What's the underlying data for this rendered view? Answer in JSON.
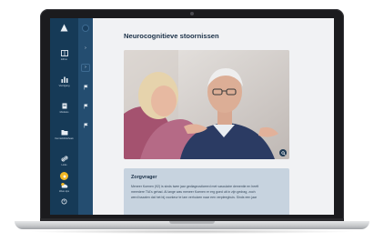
{
  "sidebar": {
    "items": [
      {
        "label": "Ethos",
        "icon": "book-icon"
      },
      {
        "label": "Voortgang",
        "icon": "bar-chart-icon"
      },
      {
        "label": "Modules",
        "icon": "document-stack-icon"
      },
      {
        "label": "Kennisbibliotheek",
        "icon": "folder-icon"
      },
      {
        "label": "Links",
        "icon": "link-icon"
      },
      {
        "label": "Weer-tips",
        "icon": "weather-icon"
      }
    ],
    "flag_icons": [
      "flag-icon",
      "flag-icon",
      "flag-icon",
      "flag-icon",
      "flag-icon"
    ],
    "bottom_icons": [
      "sun-icon",
      "settings-icon"
    ]
  },
  "page": {
    "title": "Neurocognitieve stoornissen"
  },
  "card": {
    "title": "Zorgvrager",
    "lines": [
      "Meneer Koenen (92) is sinds twee jaar gediagnosticeerd met vasculaire dementie en heeft",
      "meerdere TIA's gehad. Al lange was meneer Koenen er erg goed uit in zijn gedrag, zoch",
      "werd bazalen dat het bij voorkeur te lam verhuizen naar een verpleeghuis. Sinds een jaar"
    ]
  },
  "colors": {
    "sidebar": "#153955",
    "sidebar_flag_column": "#244d70",
    "content_bg": "#f1f2f4",
    "card_bg": "#c7d3df",
    "title": "#1a3047",
    "accent": "#f2b825"
  }
}
